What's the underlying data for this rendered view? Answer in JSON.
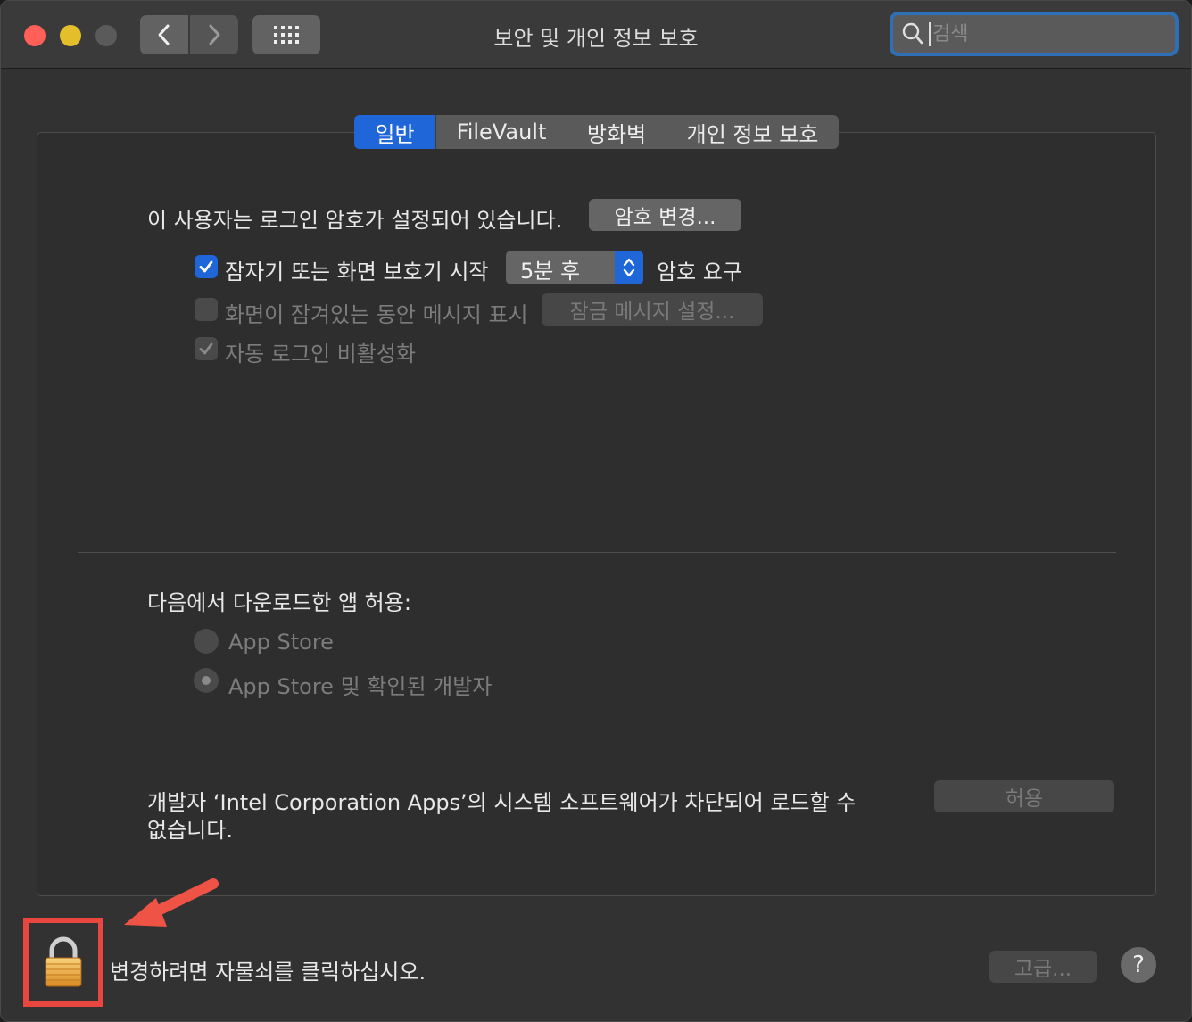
{
  "window": {
    "title": "보안 및 개인 정보 보호",
    "search_placeholder": "검색",
    "traffic_lights": [
      "close",
      "minimize",
      "zoom"
    ],
    "nav_icons": [
      "chevron-left-icon",
      "chevron-right-icon",
      "grid-icon"
    ]
  },
  "tabs": [
    {
      "label": "일반",
      "active": true
    },
    {
      "label": "FileVault",
      "active": false
    },
    {
      "label": "방화벽",
      "active": false
    },
    {
      "label": "개인 정보 보호",
      "active": false
    }
  ],
  "general": {
    "password_set_text": "이 사용자는 로그인 암호가 설정되어 있습니다.",
    "change_password_button": "암호 변경...",
    "require_password_checkbox": {
      "label": "잠자기 또는 화면 보호기 시작",
      "checked": true
    },
    "require_password_select": "5분 후",
    "require_password_suffix": "암호 요구",
    "show_message_checkbox": {
      "label": "화면이 잠겨있는 동안 메시지 표시",
      "checked": false,
      "disabled": true
    },
    "set_lock_message_button": "잠금 메시지 설정...",
    "disable_autologin_checkbox": {
      "label": "자동 로그인 비활성화",
      "checked": true,
      "disabled": true
    }
  },
  "downloads": {
    "heading": "다음에서 다운로드한 앱 허용:",
    "options": [
      {
        "label": "App Store",
        "selected": false
      },
      {
        "label": "App Store 및 확인된 개발자",
        "selected": true
      }
    ]
  },
  "blocked": {
    "message_line1": "개발자 ‘Intel Corporation Apps’의 시스템 소프트웨어가 차단되어 로드할 수",
    "message_line2": "없습니다.",
    "allow_button": "허용"
  },
  "footer": {
    "lock_text": "변경하려면 자물쇠를 클릭하십시오.",
    "advanced_button": "고급...",
    "help_button": "?"
  },
  "colors": {
    "accent": "#1f66d9",
    "highlight_box": "#e9463f",
    "annotation_arrow": "#ef5346"
  }
}
